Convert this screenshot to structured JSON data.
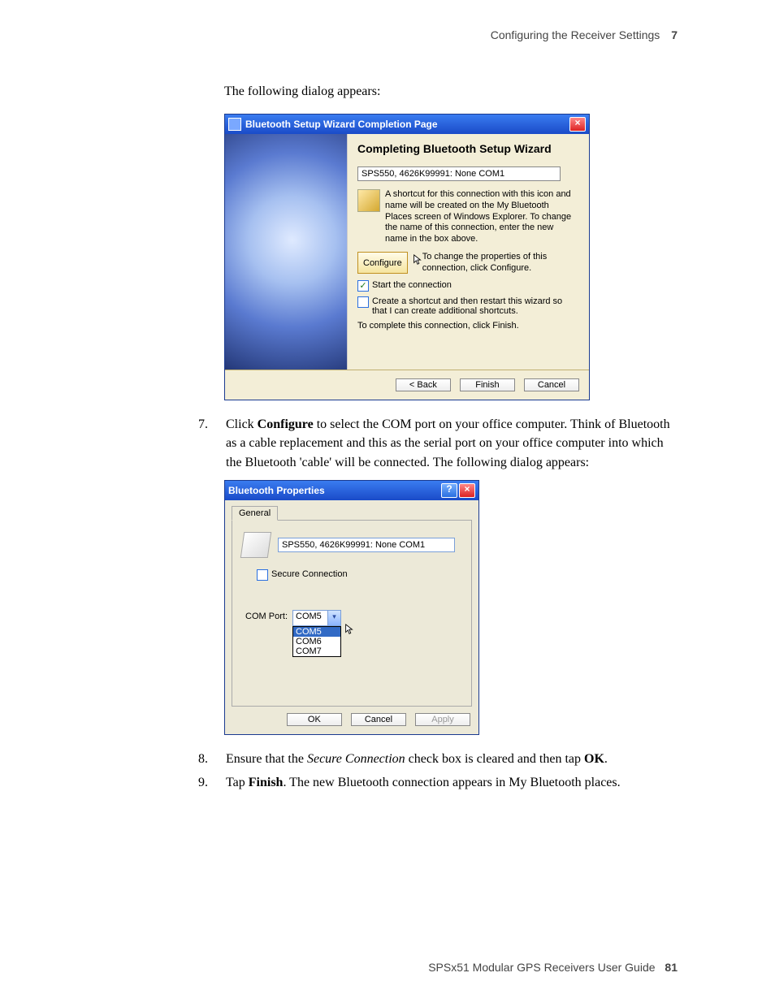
{
  "header": {
    "title": "Configuring the Receiver Settings",
    "chapter": "7"
  },
  "intro": "The following dialog appears:",
  "dialog1": {
    "title": "Bluetooth Setup Wizard Completion Page",
    "heading": "Completing Bluetooth Setup Wizard",
    "name_field": "SPS550, 4626K99991: None COM1",
    "shortcut_text": "A shortcut for this connection with this icon and name will be created on the My Bluetooth Places screen of Windows Explorer.  To change the name of this connection, enter the new name in the box above.",
    "configure_btn": "Configure",
    "configure_text": "To change the properties of this connection, click Configure.",
    "cb_start_label": "Start the connection",
    "cb_restart_label": "Create a shortcut and then restart this wizard so that I can create additional shortcuts.",
    "complete_text": "To complete this connection, click Finish.",
    "back": "< Back",
    "finish": "Finish",
    "cancel": "Cancel"
  },
  "step7": {
    "num": "7.",
    "pre": "Click ",
    "bold": "Configure",
    "post": " to select the COM port on your office computer. Think of Bluetooth as a cable replacement and this as the serial port on your office computer into which the Bluetooth 'cable' will be connected. The following dialog appears:"
  },
  "dialog2": {
    "title": "Bluetooth Properties",
    "tab": "General",
    "name_field": "SPS550, 4626K99991: None COM1",
    "secure_label": "Secure Connection",
    "com_label": "COM Port:",
    "com_value": "COM5",
    "com_options": [
      "COM5",
      "COM6",
      "COM7"
    ],
    "ok": "OK",
    "cancel": "Cancel",
    "apply": "Apply"
  },
  "step8": {
    "num": "8.",
    "pre": "Ensure that the ",
    "ital": "Secure Connection",
    "mid": " check box is cleared and then tap ",
    "bold": "OK",
    "post": "."
  },
  "step9": {
    "num": "9.",
    "pre": "Tap ",
    "bold": "Finish",
    "post": ". The new Bluetooth connection appears in My Bluetooth places."
  },
  "footer": {
    "title": "SPSx51 Modular GPS Receivers User Guide",
    "page": "81"
  }
}
